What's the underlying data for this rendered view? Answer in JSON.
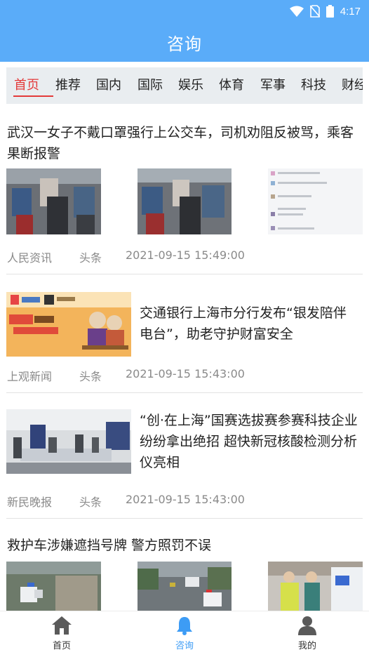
{
  "status_bar": {
    "time": "4:17",
    "icons": [
      "wifi-icon",
      "no-sim-icon",
      "battery-icon"
    ]
  },
  "header": {
    "title": "咨询"
  },
  "tabs": [
    "首页",
    "推荐",
    "国内",
    "国际",
    "娱乐",
    "体育",
    "军事",
    "科技",
    "财经"
  ],
  "active_tab": "首页",
  "articles": [
    {
      "title": "武汉一女子不戴口罩强行上公交车，司机劝阻反被骂，乘客果断报警",
      "source": "人民资讯",
      "tag": "头条",
      "time": "2021-09-15 15:49:00"
    },
    {
      "title": "交通银行上海市分行发布“银发陪伴电台”，助老守护财富安全",
      "source": "上观新闻",
      "tag": "头条",
      "time": "2021-09-15 15:43:00"
    },
    {
      "title": "“创·在上海”国赛选拔赛参赛科技企业纷纷拿出绝招 超快新冠核酸检测分析仪亮相",
      "source": "新民晚报",
      "tag": "头条",
      "time": "2021-09-15 15:43:00"
    },
    {
      "title": "救护车涉嫌遮挡号牌 警方照罚不误"
    }
  ],
  "bottom_nav": [
    {
      "label": "首页",
      "icon": "home-icon"
    },
    {
      "label": "咨询",
      "icon": "bell-icon"
    },
    {
      "label": "我的",
      "icon": "user-icon"
    }
  ],
  "colors": {
    "primary": "#5aacf9",
    "active_tab": "#e33a3a",
    "meta": "#8a8a8a"
  }
}
